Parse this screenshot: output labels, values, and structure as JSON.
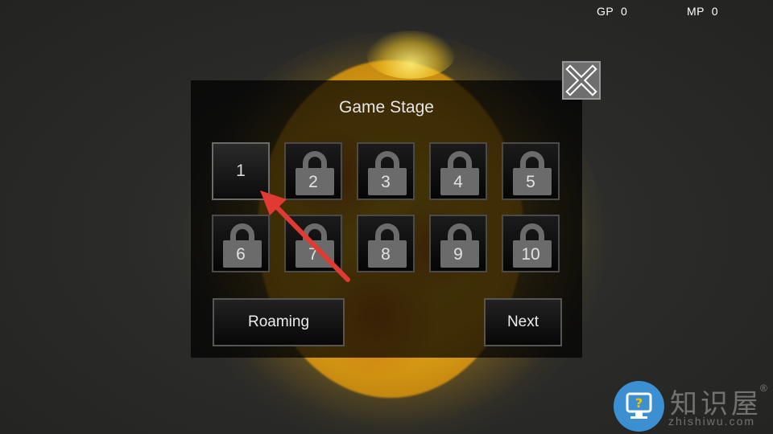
{
  "hud": {
    "gp_label": "GP",
    "gp_value": "0",
    "mp_label": "MP",
    "mp_value": "0"
  },
  "panel": {
    "title": "Game Stage"
  },
  "stages": [
    {
      "label": "1",
      "locked": false
    },
    {
      "label": "2",
      "locked": true
    },
    {
      "label": "3",
      "locked": true
    },
    {
      "label": "4",
      "locked": true
    },
    {
      "label": "5",
      "locked": true
    },
    {
      "label": "6",
      "locked": true
    },
    {
      "label": "7",
      "locked": true
    },
    {
      "label": "8",
      "locked": true
    },
    {
      "label": "9",
      "locked": true
    },
    {
      "label": "10",
      "locked": true
    }
  ],
  "buttons": {
    "roaming": "Roaming",
    "next": "Next"
  },
  "icons": {
    "close": "close-icon",
    "lock": "lock-icon"
  },
  "watermark": {
    "cn_text": "知识屋",
    "reg_mark": "®",
    "url": "zhishiwu.com"
  },
  "colors": {
    "annotation_arrow": "#e03a32",
    "sun": "#f2c21c",
    "watermark_badge": "#3c8fd0"
  }
}
